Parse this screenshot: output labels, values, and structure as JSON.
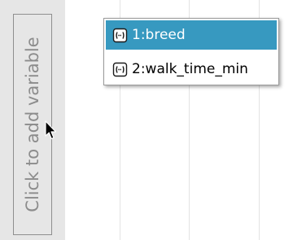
{
  "add_variable": {
    "label": "Click to add variable"
  },
  "variable_menu": {
    "items": [
      {
        "label": "1:breed",
        "icon": "variable-icon",
        "selected": true
      },
      {
        "label": "2:walk_time_min",
        "icon": "variable-icon",
        "selected": false
      }
    ]
  },
  "colors": {
    "selection": "#3799c0",
    "strip_background": "#e6e6e6",
    "grid": "#e3e3e3"
  }
}
